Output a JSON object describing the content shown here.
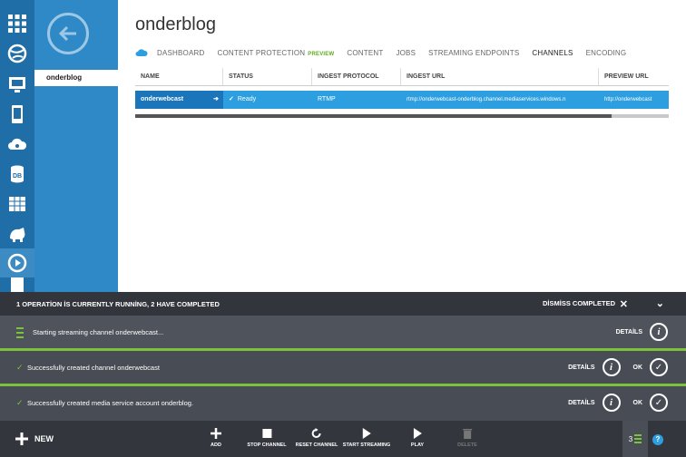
{
  "rail": {
    "icons": [
      "all-items-icon",
      "web-sites-icon",
      "virtual-machines-icon",
      "mobile-services-icon",
      "cloud-services-icon",
      "sql-databases-icon",
      "storage-icon",
      "hdinsight-icon",
      "media-services-icon",
      "reports-icon"
    ]
  },
  "subnav": {
    "item": "onderblog"
  },
  "main": {
    "title": "onderblog",
    "tabs": [
      {
        "label": "DASHBOARD"
      },
      {
        "label": "CONTENT PROTECTION",
        "badge": "PREVIEW"
      },
      {
        "label": "CONTENT"
      },
      {
        "label": "JOBS"
      },
      {
        "label": "STREAMING ENDPOINTS"
      },
      {
        "label": "CHANNELS"
      },
      {
        "label": "ENCODING"
      }
    ],
    "table": {
      "columns": [
        "NAME",
        "STATUS",
        "INGEST PROTOCOL",
        "INGEST URL",
        "PREVIEW URL"
      ],
      "rows": [
        {
          "name": "onderwebcast",
          "status": "Ready",
          "protocol": "RTMP",
          "ingest_url": "rtmp://onderwebcast-onderblog.channel.mediaservices.windows.n",
          "preview_url": "http://onderwebcast"
        }
      ]
    }
  },
  "ops": {
    "summary": "1 OPERATİON İS CURRENTLY RUNNİNG, 2 HAVE COMPLETED",
    "dismiss": "DİSMİSS COMPLETED",
    "items": [
      {
        "text": "Starting streaming channel onderwebcast...",
        "details": "DETAİLS"
      },
      {
        "text": "Successfully created channel onderwebcast",
        "details": "DETAİLS",
        "ok": "OK"
      },
      {
        "text": "Successfully created media service account onderblog.",
        "details": "DETAİLS",
        "ok": "OK"
      }
    ]
  },
  "cmdbar": {
    "new_label": "NEW",
    "commands": [
      "ADD",
      "STOP CHANNEL",
      "RESET CHANNEL",
      "START STREAMING",
      "PLAY",
      "DELETE"
    ],
    "ops_count": "3",
    "help": "?"
  },
  "colors": {
    "rail": "#1f6ea8",
    "subnav": "#2f89c6",
    "row_selected": "#2d9fe0",
    "progress_green": "#7cc23a",
    "cmdbar": "#33363d"
  }
}
